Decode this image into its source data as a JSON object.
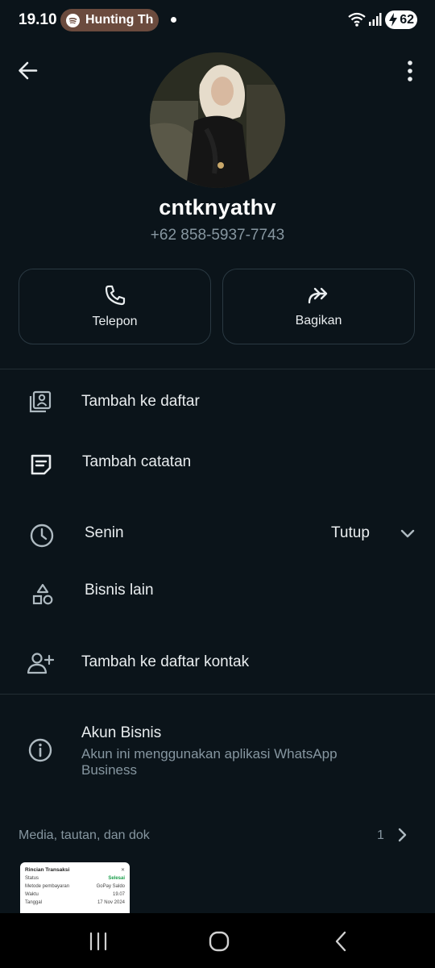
{
  "status_bar": {
    "time": "19.10",
    "now_playing": "Hunting Th",
    "battery": "62",
    "icons": [
      "spotify-icon",
      "wifi-icon",
      "signal-icon",
      "battery-icon"
    ]
  },
  "header": {
    "back_icon": "arrow-left-icon",
    "menu_icon": "more-vertical-icon"
  },
  "profile": {
    "name": "cntknyathv",
    "phone": "+62 858-5937-7743"
  },
  "actions": [
    {
      "label": "Telepon",
      "icon": "phone-icon"
    },
    {
      "label": "Bagikan",
      "icon": "share-icon"
    }
  ],
  "rows": {
    "add_to_list": "Tambah ke daftar",
    "add_note": "Tambah catatan",
    "hours_day": "Senin",
    "hours_status": "Tutup",
    "other_business": "Bisnis lain",
    "add_contact": "Tambah ke daftar kontak",
    "business_account": "Akun Bisnis",
    "business_account_desc": "Akun ini menggunakan aplikasi WhatsApp Business"
  },
  "media": {
    "label": "Media, tautan, dan dok",
    "count": "1",
    "thumb": {
      "title": "Rincian Transaksi",
      "lines": [
        {
          "k": "Status",
          "v": "Selesai"
        },
        {
          "k": "Metode pembayaran",
          "v": "GoPay Saldo"
        },
        {
          "k": "Waktu",
          "v": "19.07"
        },
        {
          "k": "Tanggal",
          "v": "17 Nov 2024"
        }
      ]
    }
  },
  "colors": {
    "background": "#0b141a",
    "text_primary": "#e9edef",
    "text_secondary": "#8696a0",
    "border": "#2a3942",
    "status_green": "#25d366"
  }
}
